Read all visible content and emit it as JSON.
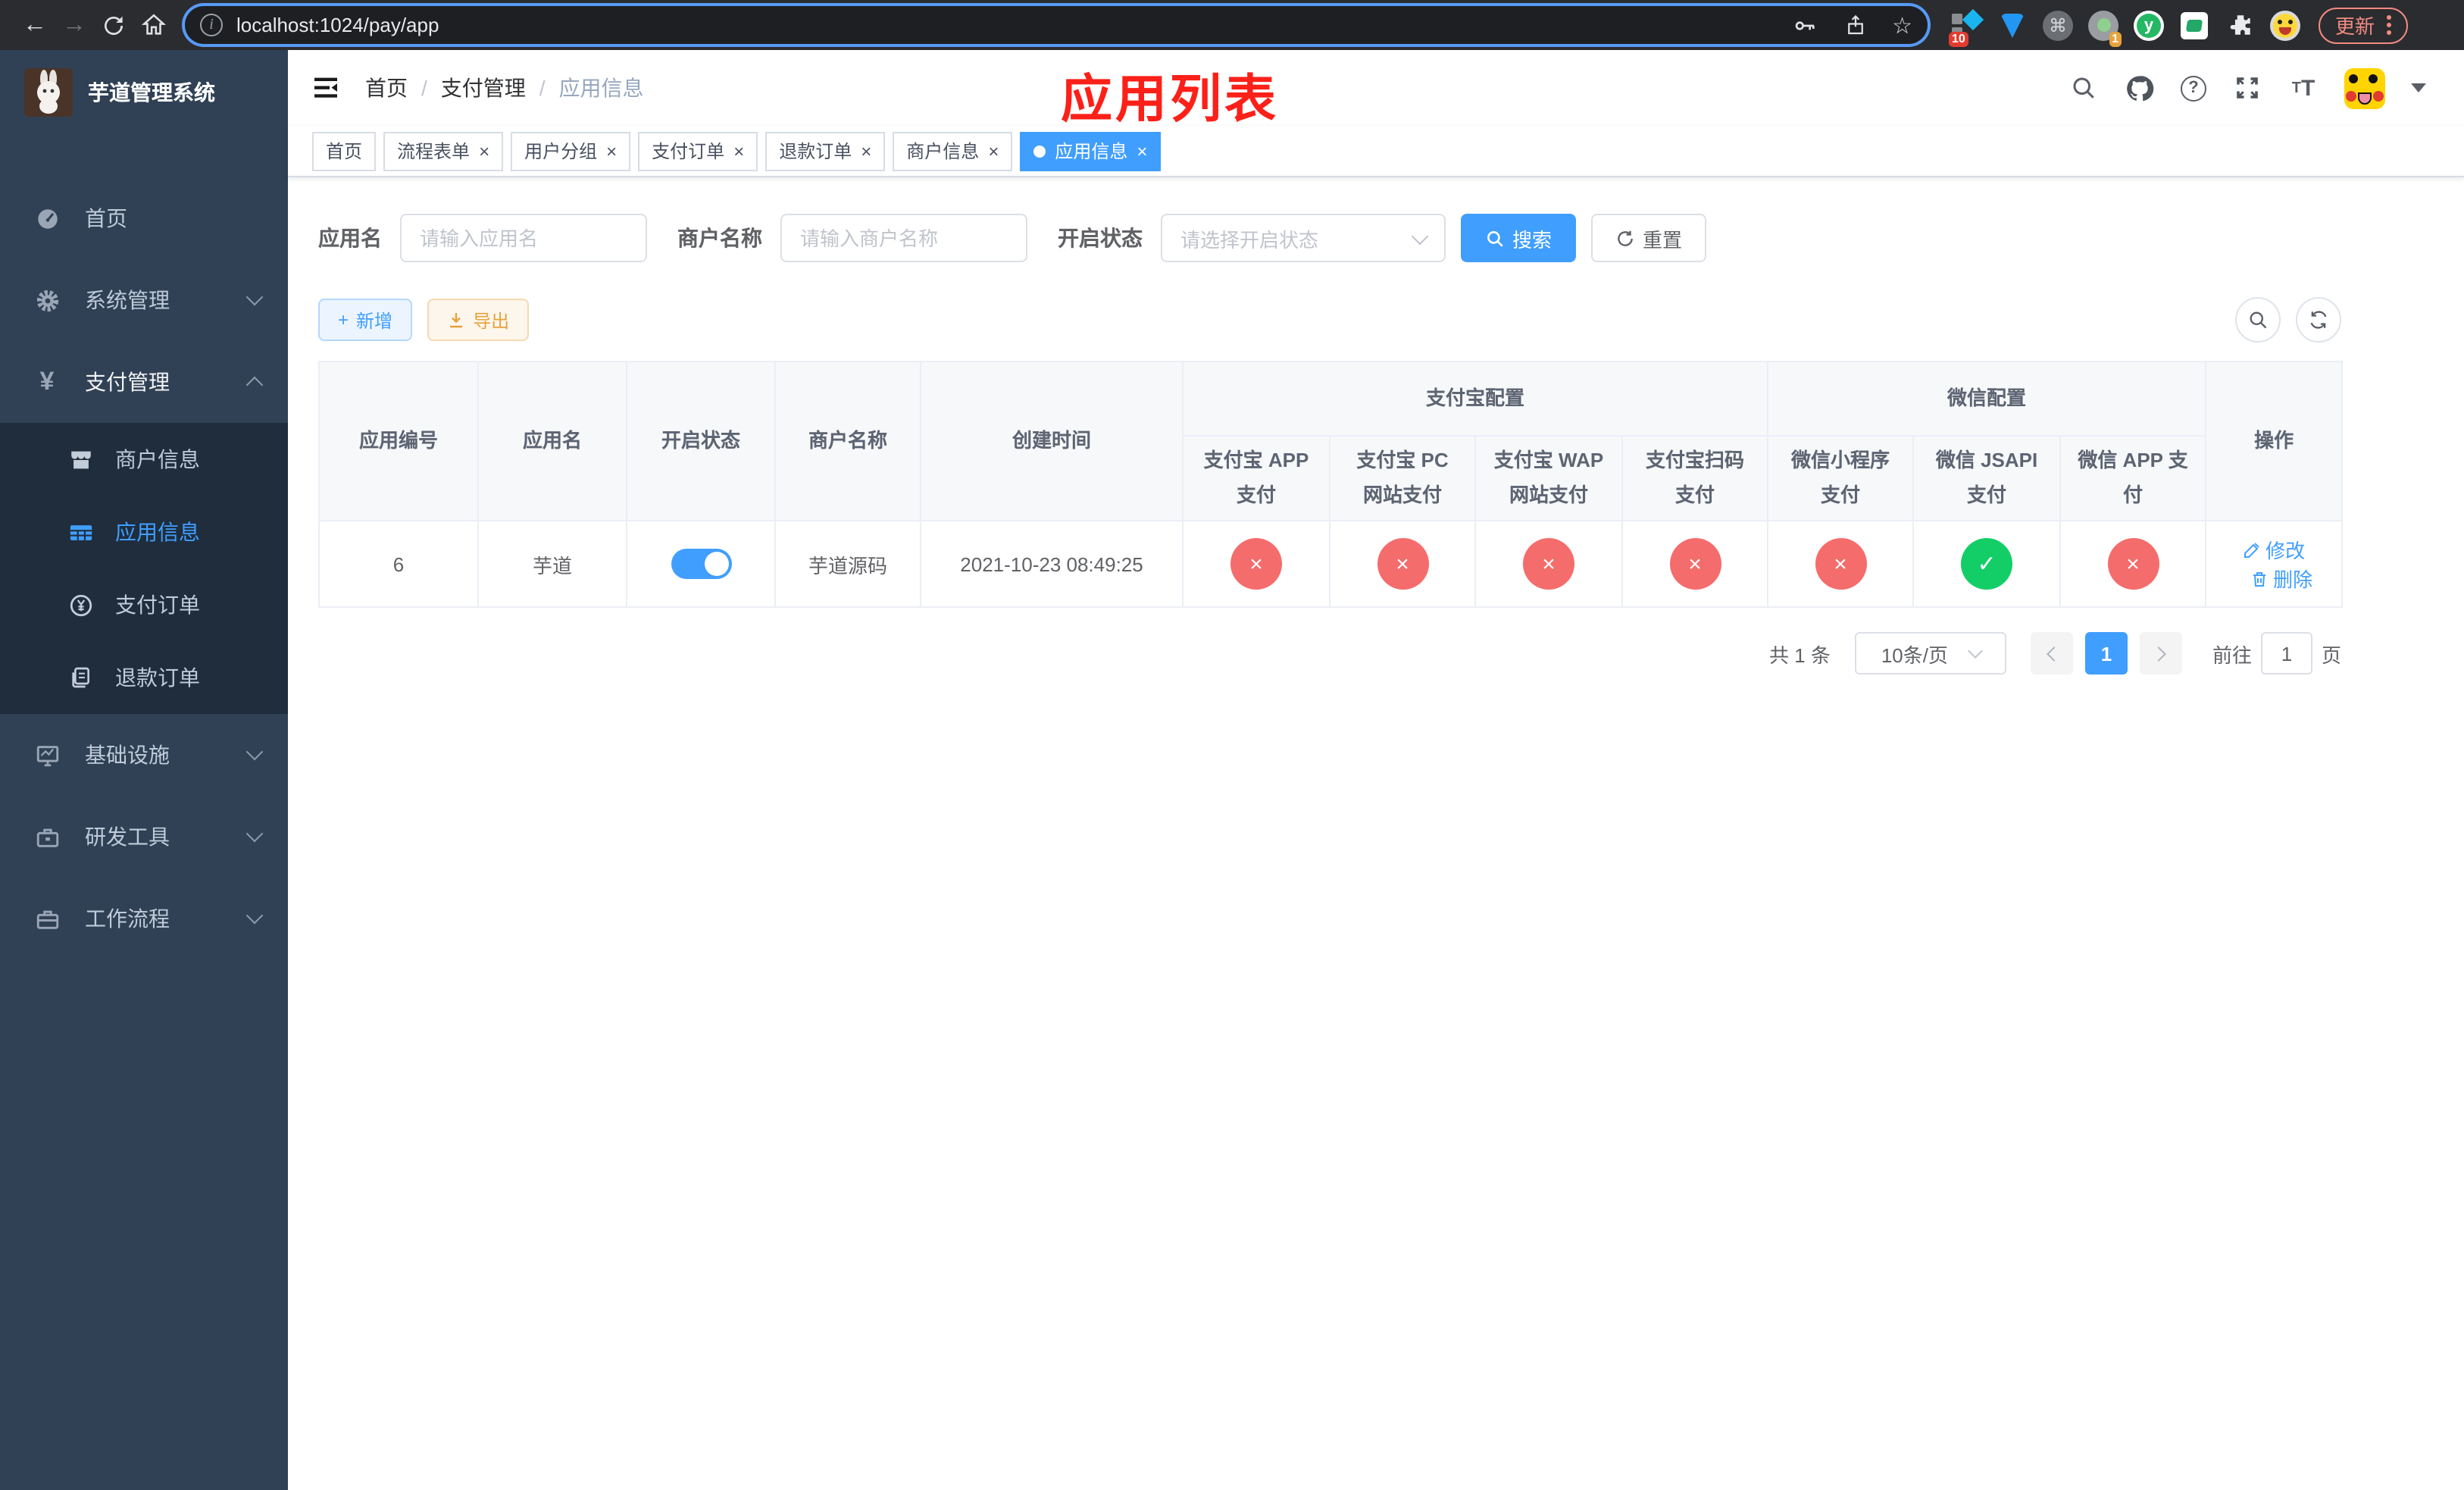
{
  "colors": {
    "accent": "#409eff",
    "danger": "#f56c6c",
    "success": "#13ce66",
    "warning": "#e6a23c",
    "annotation": "#fb2018",
    "sidebar": "#304156",
    "submenu": "#1f2d3d"
  },
  "icons": {
    "back": "←",
    "forward": "→",
    "star": "☆",
    "close": "×",
    "check": "✓",
    "cross": "×",
    "command": "⌘",
    "plus": "+",
    "question": "?",
    "yen": "¥",
    "font_large": "T",
    "font_small": "T",
    "info": "i",
    "y_letter": "y",
    "one": "1"
  },
  "browser": {
    "url": "localhost:1024/pay/app",
    "update_label": "更新",
    "ext_badge_pin": "10",
    "ext_badge_rec": "1"
  },
  "sidebar": {
    "title": "芋道管理系统",
    "menu": [
      {
        "label": "首页"
      },
      {
        "label": "系统管理"
      },
      {
        "label": "支付管理"
      },
      {
        "label": "商户信息"
      },
      {
        "label": "应用信息"
      },
      {
        "label": "支付订单"
      },
      {
        "label": "退款订单"
      },
      {
        "label": "基础设施"
      },
      {
        "label": "研发工具"
      },
      {
        "label": "工作流程"
      }
    ]
  },
  "header": {
    "breadcrumb": [
      "首页",
      "支付管理",
      "应用信息"
    ],
    "annotation": "应用列表"
  },
  "tabs": [
    {
      "label": "首页",
      "closable": false,
      "active": false
    },
    {
      "label": "流程表单",
      "closable": true,
      "active": false
    },
    {
      "label": "用户分组",
      "closable": true,
      "active": false
    },
    {
      "label": "支付订单",
      "closable": true,
      "active": false
    },
    {
      "label": "退款订单",
      "closable": true,
      "active": false
    },
    {
      "label": "商户信息",
      "closable": true,
      "active": false
    },
    {
      "label": "应用信息",
      "closable": true,
      "active": true
    }
  ],
  "filters": {
    "app_name_label": "应用名",
    "app_name_placeholder": "请输入应用名",
    "merchant_label": "商户名称",
    "merchant_placeholder": "请输入商户名称",
    "status_label": "开启状态",
    "status_placeholder": "请选择开启状态",
    "search_label": "搜索",
    "reset_label": "重置"
  },
  "toolbar": {
    "add_label": "新增",
    "export_label": "导出"
  },
  "table": {
    "col_app_id": "应用编号",
    "col_app_name": "应用名",
    "col_status": "开启状态",
    "col_merchant": "商户名称",
    "col_created": "创建时间",
    "group_alipay": "支付宝配置",
    "group_wechat": "微信配置",
    "col_alipay_app": "支付宝 APP 支付",
    "col_alipay_pc": "支付宝 PC 网站支付",
    "col_alipay_wap": "支付宝 WAP 网站支付",
    "col_alipay_qr": "支付宝扫码支付",
    "col_wx_mini": "微信小程序支付",
    "col_wx_jsapi": "微信 JSAPI 支付",
    "col_wx_app": "微信 APP 支付",
    "col_actions": "操作",
    "row": {
      "app_id": "6",
      "app_name": "芋道",
      "status_on": true,
      "merchant": "芋道源码",
      "created": "2021-10-23 08:49:25",
      "channels": [
        {
          "name": "alipay_app",
          "enabled": false
        },
        {
          "name": "alipay_pc",
          "enabled": false
        },
        {
          "name": "alipay_wap",
          "enabled": false
        },
        {
          "name": "alipay_qr",
          "enabled": false
        },
        {
          "name": "wx_mini",
          "enabled": false
        },
        {
          "name": "wx_jsapi",
          "enabled": true
        },
        {
          "name": "wx_app",
          "enabled": false
        }
      ],
      "edit_label": "修改",
      "delete_label": "删除"
    }
  },
  "pagination": {
    "total": "共 1 条",
    "page_size": "10条/页",
    "current_page": "1",
    "goto_label": "前往",
    "goto_value": "1",
    "page_unit": "页"
  }
}
